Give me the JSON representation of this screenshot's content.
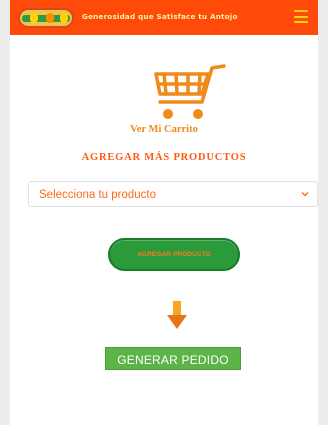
{
  "header": {
    "tagline": "Generosidad que Satisface tu Antojo",
    "logo_icon": "brand-logo",
    "menu_icon": "hamburger-menu-icon",
    "accent_color": "#ff4a0a"
  },
  "cart": {
    "icon": "shopping-cart-icon",
    "caption": "Ver Mi Carrito"
  },
  "products": {
    "title": "AGREGAR MÁS PRODUCTOS",
    "select_value": "Selecciona tu producto"
  },
  "actions": {
    "add_label": "AGREGAR PRODUCTO",
    "arrow_icon": "arrow-down-icon",
    "order_label": "GENERAR PEDIDO"
  }
}
